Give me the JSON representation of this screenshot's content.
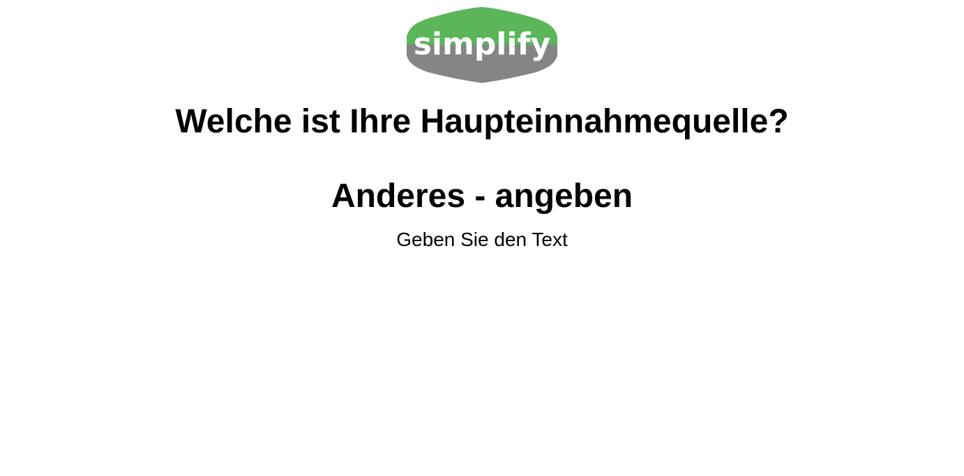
{
  "logo": {
    "text": "simplify",
    "colors": {
      "top": "#5bb65a",
      "bottom": "#838587",
      "text": "#ffffff"
    }
  },
  "question": {
    "title": "Welche ist Ihre Haupteinnahmequelle?"
  },
  "option": {
    "title": "Anderes - angeben",
    "input_prompt": "Geben Sie den Text"
  }
}
